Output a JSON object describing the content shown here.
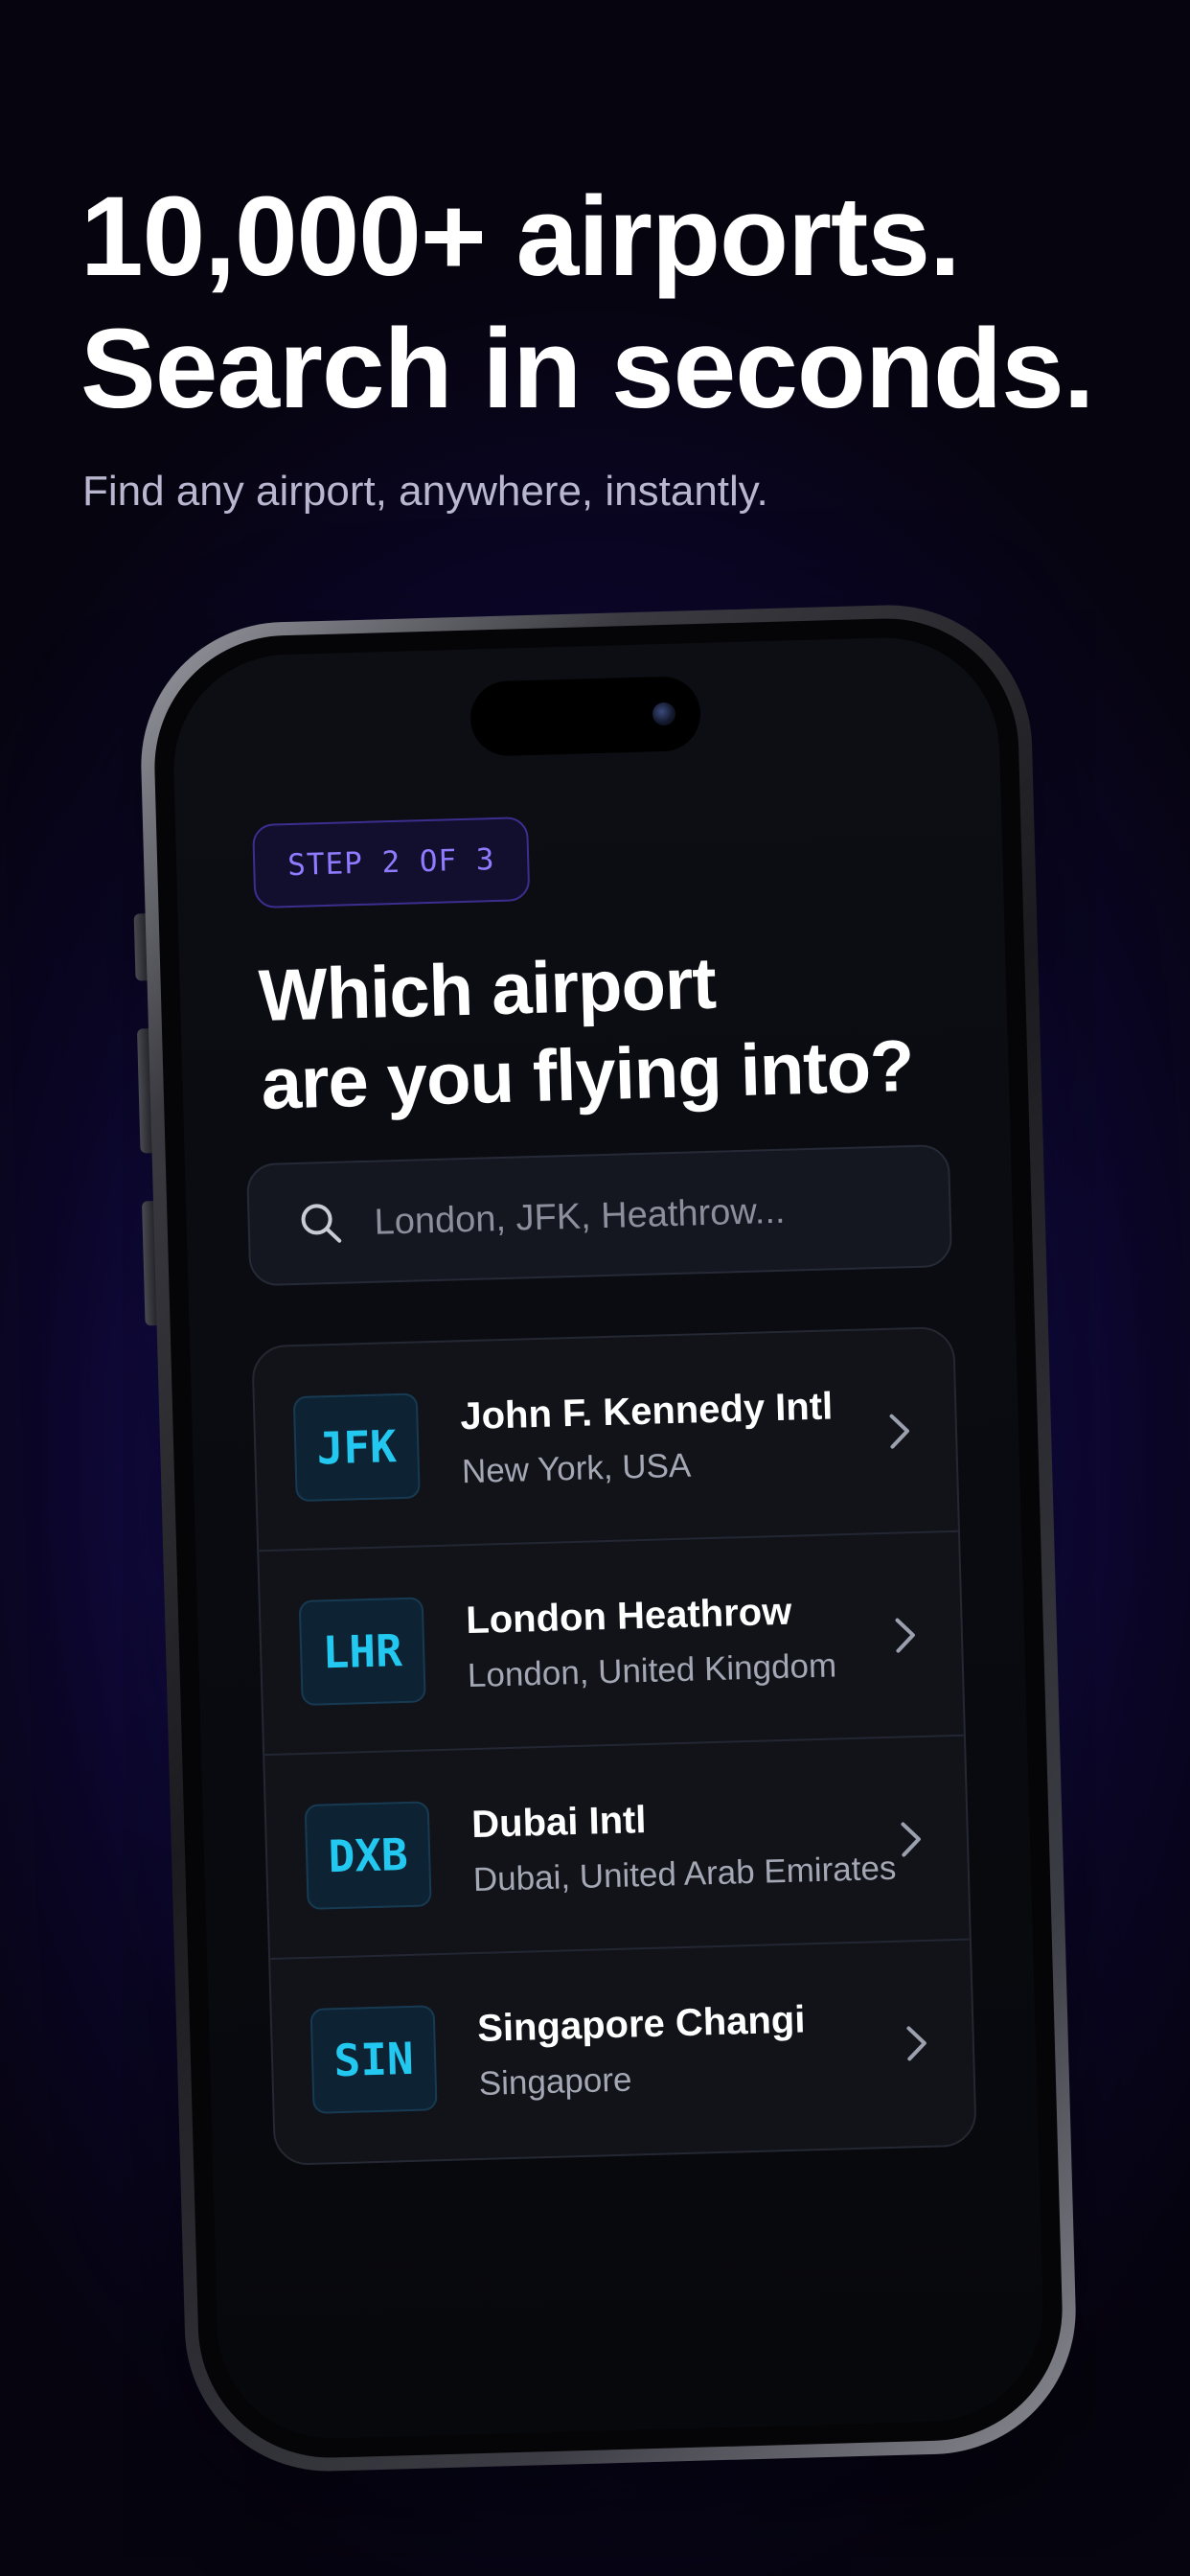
{
  "header": {
    "headline_line1": "10,000+ airports.",
    "headline_line2": "Search in seconds.",
    "subtitle": "Find any airport, anywhere, instantly."
  },
  "screen": {
    "step_badge": "STEP 2 OF 3",
    "question_line1": "Which airport",
    "question_line2": "are you flying into?",
    "search": {
      "placeholder": "London, JFK, Heathrow...",
      "value": ""
    },
    "airports": [
      {
        "code": "JFK",
        "name": "John F. Kennedy Intl",
        "location": "New York, USA"
      },
      {
        "code": "LHR",
        "name": "London Heathrow",
        "location": "London, United Kingdom"
      },
      {
        "code": "DXB",
        "name": "Dubai Intl",
        "location": "Dubai, United Arab Emirates"
      },
      {
        "code": "SIN",
        "name": "Singapore Changi",
        "location": "Singapore"
      }
    ]
  },
  "colors": {
    "accent_purple": "#8d7cff",
    "airport_code_cyan": "#22c8f0",
    "background_glow": "#3b2fb0"
  },
  "icons": {
    "search": "search-icon",
    "row_chevron": "chevron-right-icon"
  }
}
